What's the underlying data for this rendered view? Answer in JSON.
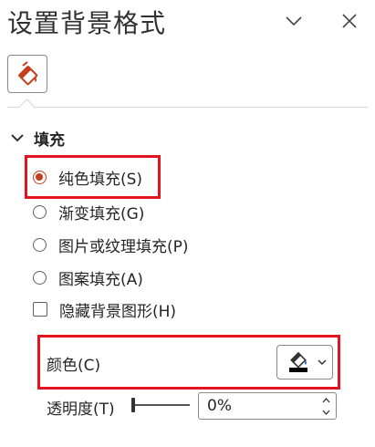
{
  "header": {
    "title": "设置背景格式"
  },
  "icons": {
    "tab_fill": "paint-bucket-icon",
    "collapse": "chevron-down-icon",
    "close": "close-icon",
    "section_toggle": "chevron-down-icon",
    "color_picker": "paint-bucket-color-icon"
  },
  "fill_section": {
    "label": "填充",
    "options": [
      {
        "label": "纯色填充(S)",
        "type": "radio",
        "checked": true
      },
      {
        "label": "渐变填充(G)",
        "type": "radio",
        "checked": false
      },
      {
        "label": "图片或纹理填充(P)",
        "type": "radio",
        "checked": false
      },
      {
        "label": "图案填充(A)",
        "type": "radio",
        "checked": false
      },
      {
        "label": "隐藏背景图形(H)",
        "type": "checkbox",
        "checked": false
      }
    ],
    "color_label": "颜色(C)",
    "transparency_label": "透明度(T)",
    "transparency_value": "0%"
  },
  "colors": {
    "accent": "#c43e1c",
    "highlight_box": "#e3141f",
    "selected_color": "#000000"
  }
}
